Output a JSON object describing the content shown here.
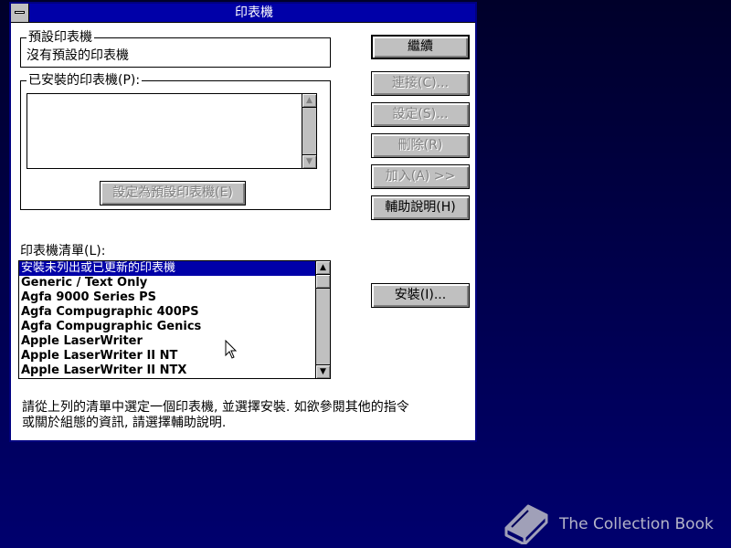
{
  "window": {
    "title": "印表機"
  },
  "default_printer": {
    "label": "預設印表機",
    "value": "沒有預設的印表機"
  },
  "installed_printers": {
    "label": "已安裝的印表機(P):",
    "set_default_button": "設定為預設印表機(E)"
  },
  "buttons": {
    "continue": "繼續",
    "connect": "連接(C)...",
    "setup": "設定(S)...",
    "remove": "刪除(R)",
    "add": "加入(A) >>",
    "help": "輔助說明(H)",
    "install": "安裝(I)..."
  },
  "printer_list": {
    "label": "印表機清單(L):",
    "items": [
      "安裝未列出或已更新的印表機",
      "Generic / Text Only",
      "Agfa 9000 Series PS",
      "Agfa Compugraphic 400PS",
      "Agfa Compugraphic Genics",
      "Apple LaserWriter",
      "Apple LaserWriter II NT",
      "Apple LaserWriter II NTX"
    ],
    "selected_index": 0
  },
  "hint": {
    "line1": "請從上列的清單中選定一個印表機, 並選擇安裝. 如欲參閱其他的指令",
    "line2": "或關於組態的資訊, 請選擇輔助說明."
  },
  "watermark": {
    "text": "The Collection Book"
  },
  "icons": {
    "system_menu": "system-menu-icon",
    "scroll_up": "arrow-up-icon",
    "scroll_down": "arrow-down-icon",
    "mouse_pointer": "mouse-pointer-icon",
    "watermark_logo": "book-icon"
  },
  "colors": {
    "title_bar": "#0000a8",
    "selection": "#0000a8",
    "button_face": "#c0c0c0",
    "desktop": "#000048"
  }
}
